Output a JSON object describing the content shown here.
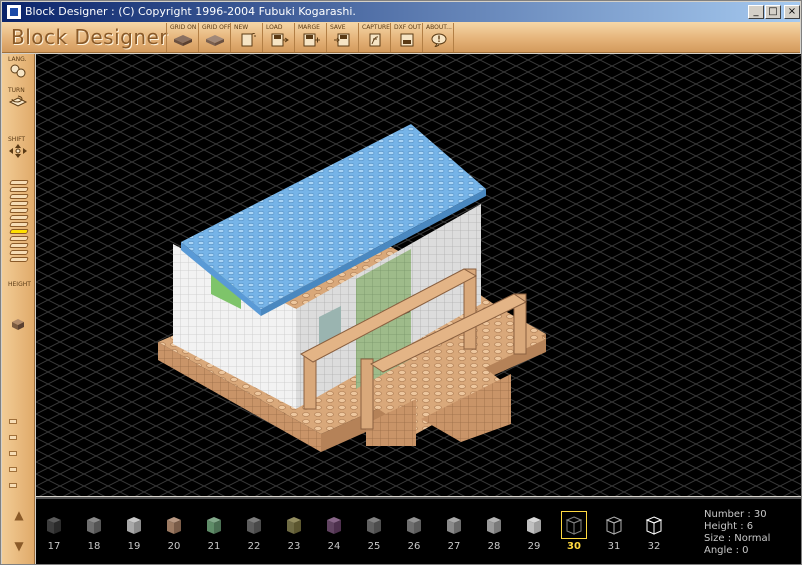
{
  "window": {
    "title": "Block Designer : (C) Copyright 1996-2004 Fubuki Kogarashi.",
    "min_glyph": "_",
    "max_glyph": "□",
    "close_glyph": "×"
  },
  "toolbar": {
    "logo": "Block Designer",
    "tools": [
      {
        "label": "GRID ON",
        "icon": "grid-on-icon"
      },
      {
        "label": "GRID OFF",
        "icon": "grid-off-icon"
      },
      {
        "label": "NEW",
        "icon": "new-file-icon"
      },
      {
        "label": "LOAD",
        "icon": "load-icon"
      },
      {
        "label": "MARGE",
        "icon": "merge-icon"
      },
      {
        "label": "SAVE",
        "icon": "save-icon"
      },
      {
        "label": "CAPTURE",
        "icon": "capture-icon"
      },
      {
        "label": "DXF OUT",
        "icon": "dxf-out-icon"
      },
      {
        "label": "ABOUT...",
        "icon": "about-icon"
      }
    ]
  },
  "leftbar": {
    "lang_label": "LANG.",
    "turn_label": "TURN",
    "shift_label": "SHIFT",
    "height_label": "HEIGHT",
    "height_levels": [
      "12",
      "11",
      "10",
      "9",
      "8",
      "7",
      "6",
      "5",
      "4",
      "3",
      "2",
      "1"
    ],
    "current_height": "6"
  },
  "palette": {
    "items": [
      {
        "number": "17",
        "color": "#3c3c3c"
      },
      {
        "number": "18",
        "color": "#6e6e6e"
      },
      {
        "number": "19",
        "color": "#a8a8a8"
      },
      {
        "number": "20",
        "color": "#9c7a62"
      },
      {
        "number": "21",
        "color": "#5f8c68"
      },
      {
        "number": "22",
        "color": "#9a9a9a"
      },
      {
        "number": "23",
        "color": "#b8b070"
      },
      {
        "number": "24",
        "color": "#a070a0"
      },
      {
        "number": "25",
        "color": "#a0a0a0"
      },
      {
        "number": "26",
        "color": "#b8b8b8"
      },
      {
        "number": "27",
        "color": "#8a8a8a"
      },
      {
        "number": "28",
        "color": "#9a9a9a"
      },
      {
        "number": "29",
        "color": "#c0c0c0"
      },
      {
        "number": "30",
        "color": "#000000"
      },
      {
        "number": "31",
        "color": "#000000"
      },
      {
        "number": "32",
        "color": "#000000"
      }
    ],
    "selected": "30"
  },
  "info": {
    "number": "Number : 30",
    "height": "Height : 6",
    "size": "Size : Normal",
    "angle": "Angle : 0"
  }
}
